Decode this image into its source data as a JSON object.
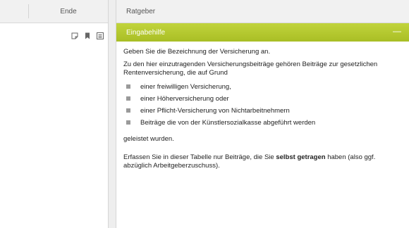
{
  "left": {
    "ende_label": "Ende",
    "tools": [
      "note-icon",
      "bookmark-icon",
      "list-icon"
    ]
  },
  "right": {
    "tab_label": "Ratgeber",
    "panel_title": "Eingabehilfe",
    "collapse_symbol": "—",
    "accent_color": "#b4c82f",
    "intro": "Geben Sie die Bezeichnung der Versicherung an.",
    "para": "Zu den hier einzutragenden Versicherungsbeiträge gehören Beiträge zur gesetzlichen Rentenversicherung, die auf Grund",
    "bullets": [
      "einer freiwilligen Versicherung,",
      "einer Höherversicherung oder",
      "einer Pflicht-Versicherung von Nichtarbeitnehmern",
      "Beiträge die von der Künstlersozialkasse abgeführt werden"
    ],
    "after_list": "geleistet wurden.",
    "final_pre": "Erfassen Sie in dieser Tabelle nur Beiträge, die Sie ",
    "final_bold": "selbst getragen",
    "final_post": " haben (also ggf. abzüglich Arbeitgeberzuschuss)."
  }
}
